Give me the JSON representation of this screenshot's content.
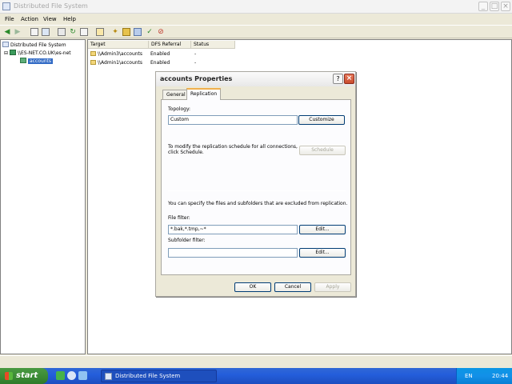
{
  "window": {
    "title": "Distributed File System",
    "min": "_",
    "max": "□",
    "close": "×"
  },
  "menu": {
    "file": "File",
    "action": "Action",
    "view": "View",
    "help": "Help"
  },
  "toolbar_icons": [
    "back-icon",
    "forward-icon",
    "up-icon",
    "show-hide-icon",
    "properties-icon",
    "refresh-icon",
    "export-icon",
    "help-icon",
    "link-icon",
    "replica-icon",
    "status-icon",
    "check-icon",
    "remove-icon"
  ],
  "tree": {
    "root": "Distributed File System",
    "server": "\\\\ES-NET.CO.UK\\es-net",
    "child": "accounts"
  },
  "list": {
    "columns": [
      "Target",
      "DFS Referral",
      "Status"
    ],
    "rows": [
      {
        "target": "\\\\Admin3\\accounts",
        "referral": "Enabled",
        "status": "-"
      },
      {
        "target": "\\\\Admin1\\accounts",
        "referral": "Enabled",
        "status": "-"
      }
    ]
  },
  "dialog": {
    "title": "accounts Properties",
    "help": "?",
    "close": "×",
    "tabs": {
      "general": "General",
      "replication": "Replication"
    },
    "topology_label": "Topology:",
    "topology_value": "Custom",
    "customize": "Customize",
    "schedule_text_1": "To modify the replication schedule for all connections,",
    "schedule_text_2": "click Schedule.",
    "schedule": "Schedule",
    "exclude_text": "You can specify the files and subfolders that are excluded from replication.",
    "file_filter_label": "File filter:",
    "file_filter_value": "*.bak,*.tmp,~*",
    "edit": "Edit...",
    "subfolder_filter_label": "Subfolder filter:",
    "subfolder_filter_value": "",
    "ok": "OK",
    "cancel": "Cancel",
    "apply": "Apply"
  },
  "taskbar": {
    "start": "start",
    "task": "Distributed File System",
    "lang": "EN",
    "clock": "20:44"
  }
}
